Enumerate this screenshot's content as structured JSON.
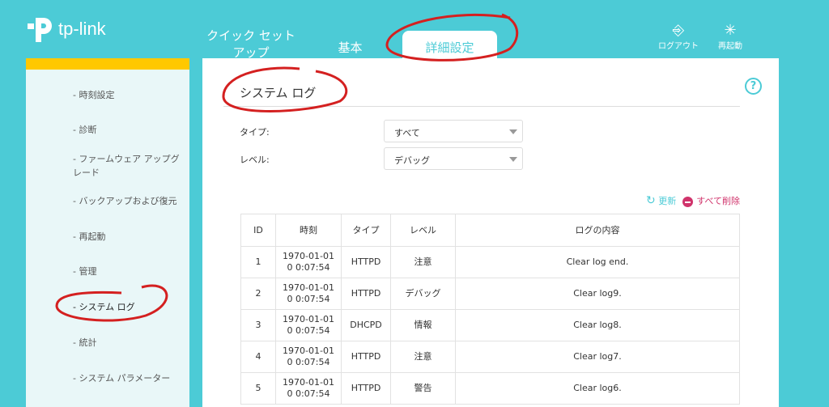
{
  "brand": "tp-link",
  "nav": {
    "quick_setup": "クイック セット アップ",
    "basic": "基本",
    "advanced": "詳細設定"
  },
  "top_actions": {
    "logout": "ログアウト",
    "reboot": "再起動"
  },
  "sidebar": {
    "items": [
      "- 時刻設定",
      "- 診断",
      "- ファームウェア アップグレード",
      "- バックアップおよび復元",
      "- 再起動",
      "- 管理",
      "- システム ログ",
      "- 統計",
      "- システム パラメーター"
    ]
  },
  "main": {
    "title": "システム ログ",
    "type_label": "タイプ:",
    "type_value": "すべて",
    "level_label": "レベル:",
    "level_value": "デバッグ",
    "refresh": "更新",
    "delete_all": "すべて削除",
    "columns": [
      "ID",
      "時刻",
      "タイプ",
      "レベル",
      "ログの内容"
    ],
    "rows": [
      [
        "1",
        "1970-01-01 0 0:07:54",
        "HTTPD",
        "注意",
        "Clear log end."
      ],
      [
        "2",
        "1970-01-01 0 0:07:54",
        "HTTPD",
        "デバッグ",
        "Clear log9."
      ],
      [
        "3",
        "1970-01-01 0 0:07:54",
        "DHCPD",
        "情報",
        "Clear log8."
      ],
      [
        "4",
        "1970-01-01 0 0:07:54",
        "HTTPD",
        "注意",
        "Clear log7."
      ],
      [
        "5",
        "1970-01-01 0 0:07:54",
        "HTTPD",
        "警告",
        "Clear log6."
      ]
    ]
  }
}
